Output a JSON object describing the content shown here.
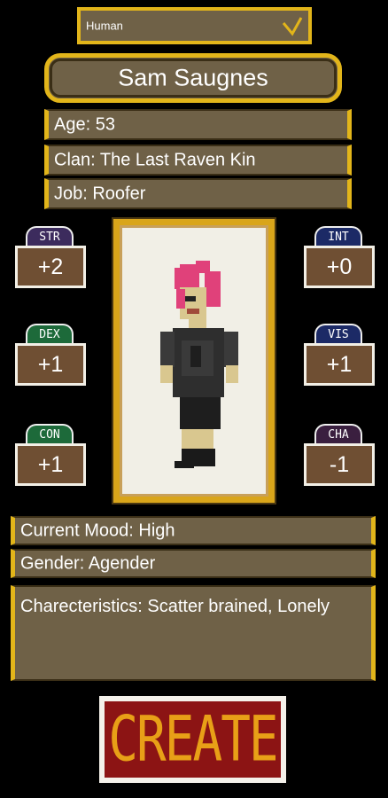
{
  "race": {
    "value": "Human"
  },
  "character": {
    "name": "Sam Saugnes"
  },
  "info": {
    "age": "Age: 53",
    "clan": "Clan: The Last Raven Kin",
    "job": "Job: Roofer"
  },
  "stats": [
    {
      "abbr": "STR",
      "value": "+2",
      "color": "#3c2b5d"
    },
    {
      "abbr": "INT",
      "value": "+0",
      "color": "#1c2a66"
    },
    {
      "abbr": "DEX",
      "value": "+1",
      "color": "#1d6a3a"
    },
    {
      "abbr": "VIS",
      "value": "+1",
      "color": "#1c2a66"
    },
    {
      "abbr": "CON",
      "value": "+1",
      "color": "#1d6a3a"
    },
    {
      "abbr": "CHA",
      "value": "-1",
      "color": "#3a1f3f"
    }
  ],
  "details": {
    "mood": "Current Mood: High",
    "gender": "Gender: Agender",
    "characteristics": "Charecteristics: Scatter brained, Lonely"
  },
  "create_label": "CREATE",
  "icons": {
    "dropdown": "chevron-down-icon"
  },
  "colors": {
    "panel": "#6f6147",
    "accent": "#e2b51a",
    "create_bg": "#8c1414",
    "create_text": "#e8a017"
  }
}
